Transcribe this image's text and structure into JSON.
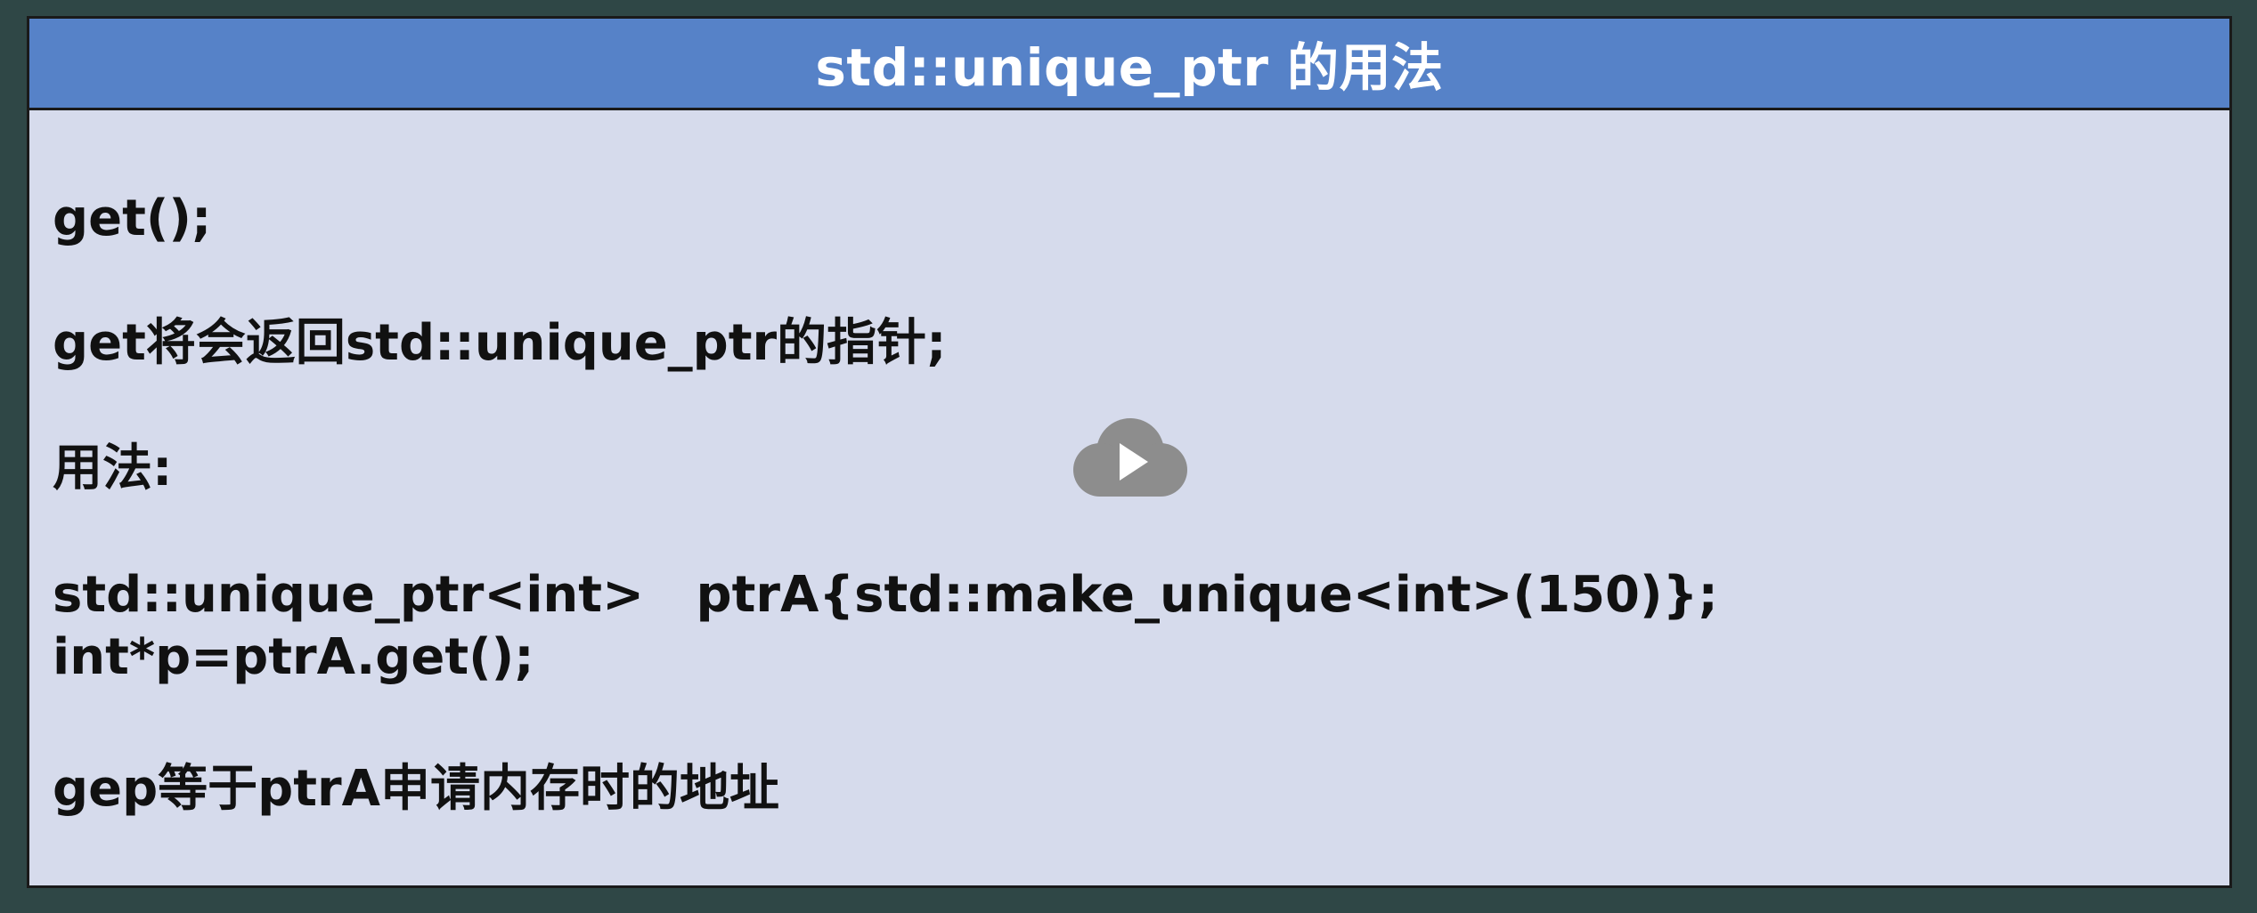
{
  "slide": {
    "title": "std::unique_ptr 的用法",
    "lines": [
      "get();",
      "get将会返回std::unique_ptr的指针;",
      "用法:",
      "std::unique_ptr<int>   ptrA{std::make_unique<int>(150)};",
      "int*p=ptrA.get();",
      "gep等于ptrA申请内存时的地址"
    ]
  },
  "player": {
    "icon": "cloud-play-icon",
    "icon_color": "#8d8d8d"
  },
  "colors": {
    "background": "#2f4746",
    "header": "#5682c8",
    "panel": "#d6dbec",
    "text": "#111111",
    "title_text": "#ffffff"
  }
}
